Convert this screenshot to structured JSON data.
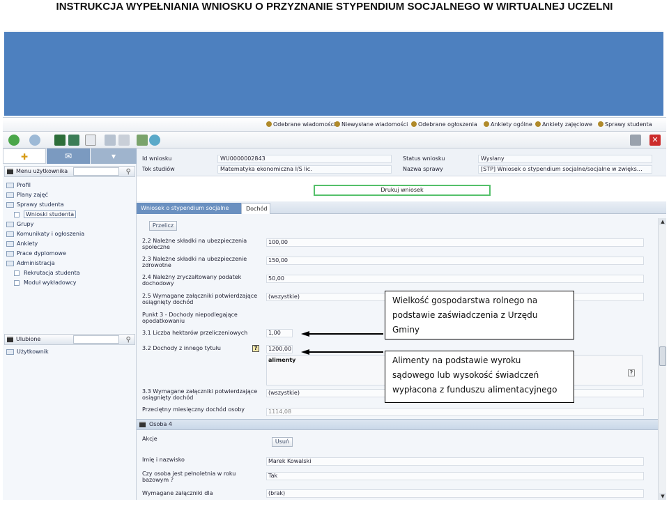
{
  "doc_title": "INSTRUKCJA WYPEŁNIANIA WNIOSKU O PRZYZNANIE STYPENDIUM SOCJALNEGO  W WIRTUALNEJ UCZELNI",
  "links": [
    "Odebrane wiadomości",
    "Niewysłane wiadomości",
    "Odebrane ogłoszenia",
    "Ankiety ogólne",
    "Ankiety zajęciowe",
    "Sprawy studenta"
  ],
  "toolbar": {
    "icons": [
      "back-arrow-icon",
      "forward-arrow-icon",
      "panel-icon",
      "mail-icon",
      "new-doc-icon",
      "save-icon",
      "delete-icon",
      "check-icon",
      "refresh-icon"
    ],
    "right_icons": [
      "tools-icon",
      "close-icon"
    ]
  },
  "sidebar": {
    "menu_header": "Menu użytkownika",
    "items": [
      {
        "label": "Profil"
      },
      {
        "label": "Plany zajęć"
      },
      {
        "label": "Sprawy studenta"
      },
      {
        "label": "Wnioski studenta",
        "sub": true,
        "selected": true
      },
      {
        "label": "Grupy"
      },
      {
        "label": "Komunikaty i ogłoszenia"
      },
      {
        "label": "Ankiety"
      },
      {
        "label": "Prace dyplomowe"
      },
      {
        "label": "Administracja"
      },
      {
        "label": "Rekrutacja studenta",
        "sub": true
      },
      {
        "label": "Moduł wykładowcy",
        "sub": true
      }
    ],
    "fav_header": "Ulubione",
    "fav_items": [
      {
        "label": "Użytkownik"
      }
    ]
  },
  "header": {
    "id_label": "Id wniosku",
    "id_value": "WU0000002843",
    "tok_label": "Tok studiów",
    "tok_value": "Matematyka ekonomiczna I/S lic.",
    "status_label": "Status wniosku",
    "status_value": "Wysłany",
    "name_label": "Nazwa sprawy",
    "name_value": "[STP] Wniosek o stypendium socjalne/socjalne w zwięks…"
  },
  "print_button": "Drukuj wniosek",
  "tabs": [
    "Wniosek o stypendium socjalne",
    "Dochód"
  ],
  "recalc_button": "Przelicz",
  "rows": [
    {
      "label": "2.2 Należne składki na ubezpieczenia społeczne",
      "value": "100,00"
    },
    {
      "label": "2.3 Należne składki na ubezpieczenie zdrowotne",
      "value": "150,00"
    },
    {
      "label": "2.4 Należny zryczałtowany podatek dochodowy",
      "value": "50,00"
    },
    {
      "label": "2.5 Wymagane załączniki potwierdzające osiągnięty dochód",
      "value": "(wszystkie)"
    },
    {
      "label": "Punkt 3 - Dochody niepodlegające opodatkowaniu",
      "value": ""
    },
    {
      "label": "3.1 Liczba hektarów przeliczeniowych",
      "value": "1,00"
    },
    {
      "label": "3.2 Dochody z innego tytułu",
      "value": "1200,00"
    },
    {
      "label": "3.3 Wymagane załączniki potwierdzające osiągnięty dochód",
      "value": "(wszystkie)"
    },
    {
      "label": "Przeciętny miesięczny dochód osoby",
      "value": "1114,08"
    }
  ],
  "textarea_value": "alimenty",
  "help_mark": "?",
  "person_header": "Osoba 4",
  "person": {
    "actions_label": "Akcje",
    "remove_button": "Usuń",
    "name_label": "Imię i nazwisko",
    "name_value": "Marek Kowalski",
    "adult_label": "Czy osoba jest pełnoletnia w roku bazowym ?",
    "adult_value": "Tak",
    "att_label": "Wymagane załączniki dla",
    "att_value": "(brak)"
  },
  "callouts": {
    "c1": [
      "Wielkość gospodarstwa rolnego na",
      "podstawie zaświadczenia z Urzędu",
      "Gminy"
    ],
    "c2": [
      "Alimenty na podstawie wyroku",
      "sądowego lub wysokość świadczeń",
      "wypłacona z funduszu alimentacyjnego"
    ]
  },
  "colors": {
    "banner": "#4d80bf",
    "tab_active": "#6a90c0",
    "print_border": "#54c06a"
  }
}
